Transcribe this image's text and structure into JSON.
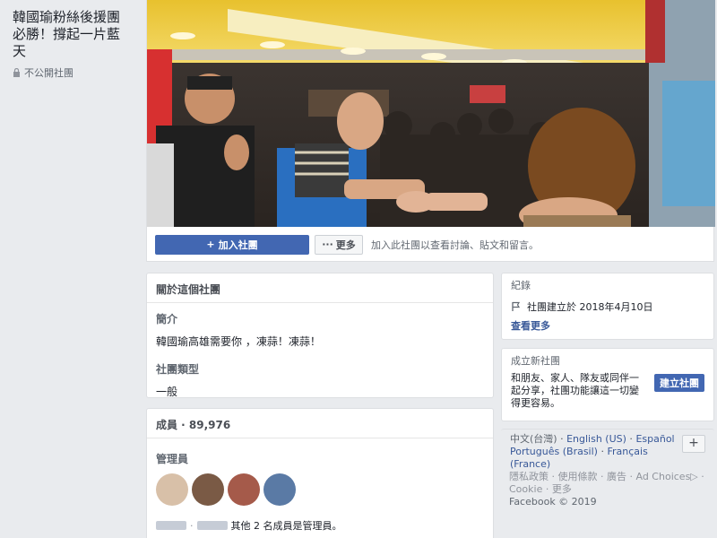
{
  "group": {
    "name": "韓國瑜粉絲後援團必勝！撐起一片藍天",
    "privacy": "不公開社團"
  },
  "actions": {
    "join_label": "加入社團",
    "more_label": "更多",
    "join_hint": "加入此社團以查看討論、貼文和留言。"
  },
  "about": {
    "header": "關於這個社團",
    "intro_label": "簡介",
    "intro_text": "韓國瑜高雄需要你 ，凍蒜！凍蒜！",
    "type_label": "社團類型",
    "type_value": "一般"
  },
  "members": {
    "header": "成員 · 89,976",
    "admins_label": "管理員",
    "admin_note": "其他 2 名成員是管理員。"
  },
  "record": {
    "header": "紀錄",
    "created": "社團建立於 2018年4月10日",
    "see_more": "查看更多"
  },
  "create_group": {
    "header": "成立新社團",
    "text": "和朋友、家人、隊友或同伴一起分享，社團功能讓這一切變得更容易。",
    "button": "建立社團"
  },
  "languages": {
    "current": "中文(台灣)",
    "items": [
      "English (US)",
      "Español",
      "Português (Brasil)",
      "Français (France)"
    ],
    "plus": "+"
  },
  "footer": {
    "links": [
      "隱私政策",
      "使用條款",
      "廣告",
      "Ad Choices",
      "Cookie",
      "更多"
    ],
    "copyright": "Facebook © 2019"
  },
  "icons": {
    "lock": "lock-icon",
    "plus": "plus-icon",
    "more": "ellipsis-icon",
    "flag": "flag-icon",
    "adchoices": "adchoices-icon"
  },
  "colors": {
    "brand_blue": "#4267b2",
    "link": "#385898",
    "background": "#e9ebee"
  }
}
